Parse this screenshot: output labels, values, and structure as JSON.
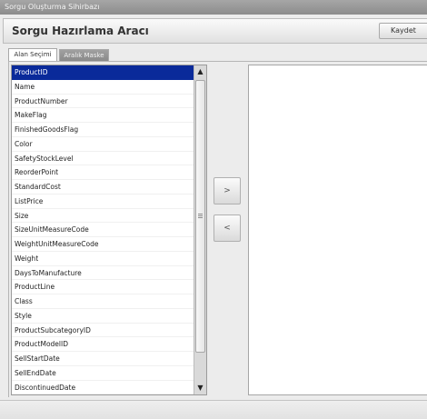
{
  "window": {
    "title": "Sorgu Oluşturma Sihirbazı"
  },
  "header": {
    "title": "Sorgu Hazırlama Aracı",
    "save_label": "Kaydet"
  },
  "tabs": [
    {
      "label": "Alan Seçimi"
    },
    {
      "label": "Aralık Maske"
    }
  ],
  "field_list": {
    "items": [
      "ProductID",
      "Name",
      "ProductNumber",
      "MakeFlag",
      "FinishedGoodsFlag",
      "Color",
      "SafetyStockLevel",
      "ReorderPoint",
      "StandardCost",
      "ListPrice",
      "Size",
      "SizeUnitMeasureCode",
      "WeightUnitMeasureCode",
      "Weight",
      "DaysToManufacture",
      "ProductLine",
      "Class",
      "Style",
      "ProductSubcategoryID",
      "ProductModelID",
      "SellStartDate",
      "SellEndDate",
      "DiscontinuedDate"
    ],
    "selected": "ProductID"
  },
  "actions": {
    "add_label": ">",
    "remove_label": "<"
  },
  "scrollbar": {
    "up": "▲",
    "down": "▼"
  }
}
